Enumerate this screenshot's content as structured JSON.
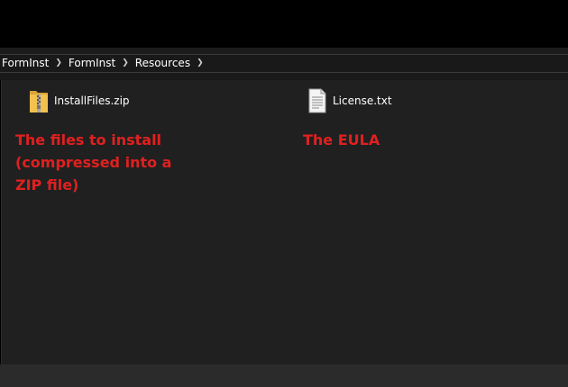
{
  "breadcrumb": {
    "items": [
      "FormInst",
      "FormInst",
      "Resources"
    ]
  },
  "files": [
    {
      "name": "InstallFiles.zip",
      "icon": "zip-folder-icon"
    },
    {
      "name": "License.txt",
      "icon": "text-document-icon"
    }
  ],
  "annotations": {
    "zip": "The files to install\n(compressed into a\nZIP file)",
    "license": "The EULA"
  },
  "colors": {
    "annotation": "#e02020",
    "background": "#202020",
    "folder": "#f2c14e"
  }
}
